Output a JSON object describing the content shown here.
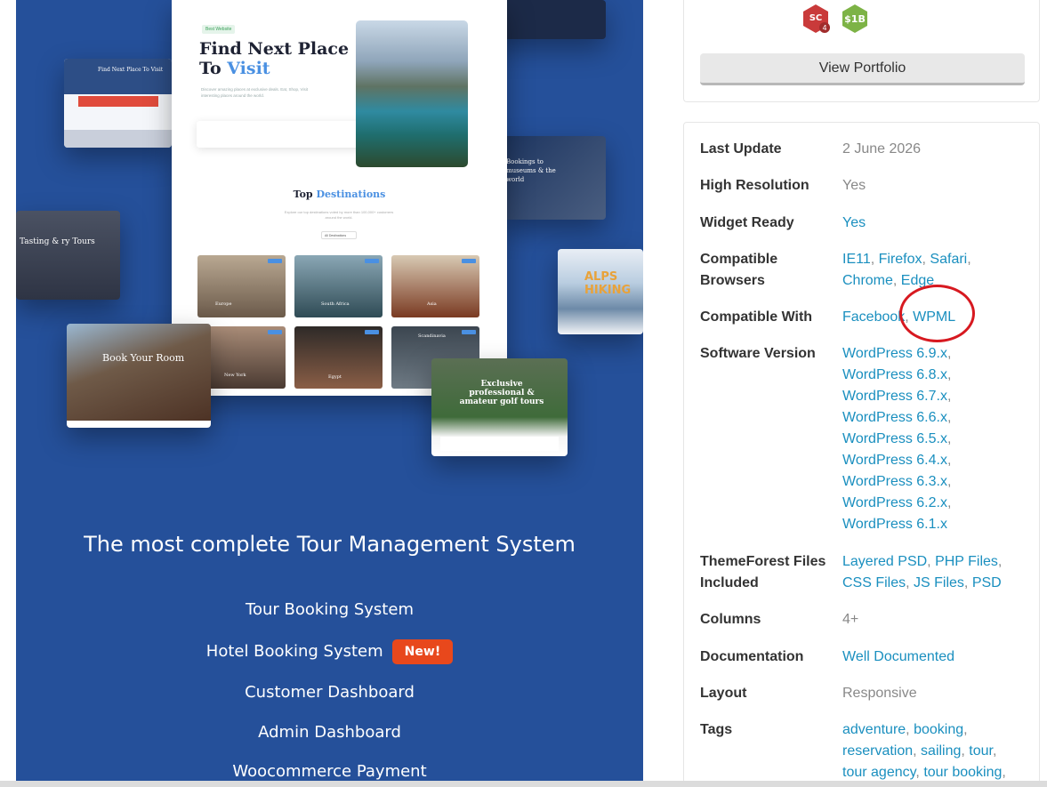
{
  "promo": {
    "hero_tag": "Best Website",
    "hero_title_line1": "Find Next Place",
    "hero_title_line2_plain": "To ",
    "hero_title_line2_accent": "Visit",
    "hero_sub": "Discover amazing places at exclusive deals. Eat, Shop, Visit interesting places around the world.",
    "top_dest_plain": "Top ",
    "top_dest_accent": "Destinations",
    "dest_sub": "Explore our top destinations voted by more than 100,000+ customers around the world.",
    "dest_select": "All Destinations",
    "dest_cards": [
      "Europe",
      "South Africa",
      "Asia",
      "New York",
      "Egypt",
      "Scandinavia"
    ],
    "side_a_title": "Find Next Place To Visit",
    "side_b_title": "Tasting & ry Tours",
    "side_c_title": "Book Your Room",
    "side_e_title": "Bookings to museums & the world",
    "side_f_title": "ALPS HIKING",
    "side_g_title": "Exclusive professional & amateur golf tours",
    "heading": "The most complete Tour Management System",
    "features": [
      "Tour Booking System",
      "Hotel Booking System",
      "Customer Dashboard",
      "Admin Dashboard",
      "Woocommerce Payment"
    ],
    "new_badge": "New!"
  },
  "author": {
    "badges": [
      {
        "label": "SC",
        "sub": "4",
        "color": "#c93a3a"
      },
      {
        "label": "$1B",
        "color": "#7db346"
      }
    ],
    "view_portfolio": "View Portfolio"
  },
  "info": {
    "last_update": {
      "label": "Last Update",
      "value": "2 June 2026"
    },
    "high_resolution": {
      "label": "High Resolution",
      "value": "Yes"
    },
    "widget_ready": {
      "label": "Widget Ready",
      "value": "Yes"
    },
    "compatible_browsers": {
      "label_line1": "Compatible",
      "label_line2": "Browsers",
      "values": [
        "IE11",
        "Firefox",
        "Safari",
        "Chrome",
        "Edge"
      ]
    },
    "compatible_with": {
      "label": "Compatible With",
      "values": [
        "Facebook",
        "WPML"
      ]
    },
    "software_version": {
      "label": "Software Version",
      "values": [
        "WordPress 6.9.x",
        "WordPress 6.8.x",
        "WordPress 6.7.x",
        "WordPress 6.6.x",
        "WordPress 6.5.x",
        "WordPress 6.4.x",
        "WordPress 6.3.x",
        "WordPress 6.2.x",
        "WordPress 6.1.x"
      ]
    },
    "files_included": {
      "label_line1": "ThemeForest Files",
      "label_line2": "Included",
      "values": [
        "Layered PSD",
        "PHP Files",
        "CSS Files",
        "JS Files",
        "PSD"
      ]
    },
    "columns": {
      "label": "Columns",
      "value": "4+"
    },
    "documentation": {
      "label": "Documentation",
      "value": "Well Documented"
    },
    "layout": {
      "label": "Layout",
      "value": "Responsive"
    },
    "tags": {
      "label": "Tags",
      "values": [
        "adventure",
        "booking",
        "reservation",
        "sailing",
        "tour",
        "tour agency",
        "tour booking"
      ]
    }
  }
}
